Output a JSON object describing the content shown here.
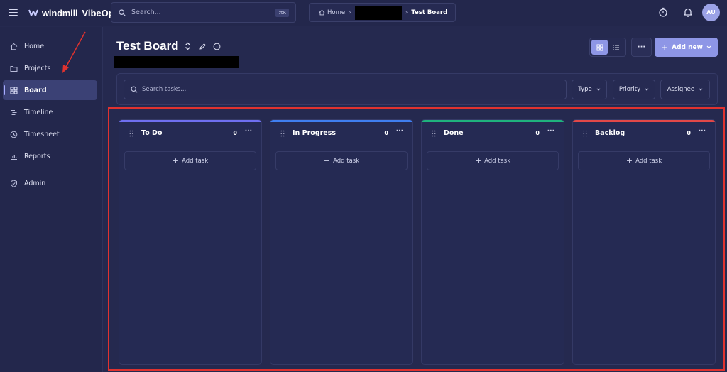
{
  "app": {
    "logo_text": "windmill",
    "product": "VibeOps"
  },
  "search": {
    "placeholder": "Search...",
    "shortcut": "⌘K"
  },
  "breadcrumb": {
    "home": "Home",
    "current": "Test Board"
  },
  "user": {
    "initials": "AU"
  },
  "sidebar": {
    "items": [
      {
        "label": "Home",
        "icon": "home-icon"
      },
      {
        "label": "Projects",
        "icon": "folder-icon"
      },
      {
        "label": "Board",
        "icon": "grid-icon",
        "active": true
      },
      {
        "label": "Timeline",
        "icon": "timeline-icon"
      },
      {
        "label": "Timesheet",
        "icon": "clock-icon"
      },
      {
        "label": "Reports",
        "icon": "chart-icon"
      },
      {
        "label": "Admin",
        "icon": "shield-icon"
      }
    ]
  },
  "board": {
    "title": "Test Board",
    "add_new": "Add new",
    "more": "···",
    "task_search_placeholder": "Search tasks...",
    "filters": [
      "Type",
      "Priority",
      "Assignee"
    ],
    "columns": [
      {
        "name": "To Do",
        "count": "0",
        "color": "#6f6ff0",
        "add_label": "Add task"
      },
      {
        "name": "In Progress",
        "count": "0",
        "color": "#3f7ef0",
        "add_label": "Add task"
      },
      {
        "name": "Done",
        "count": "0",
        "color": "#1fb27d",
        "add_label": "Add task"
      },
      {
        "name": "Backlog",
        "count": "0",
        "color": "#e24848",
        "add_label": "Add task"
      }
    ]
  },
  "colors": {
    "accent": "#8e96e6",
    "highlight_border": "#e0322f"
  }
}
